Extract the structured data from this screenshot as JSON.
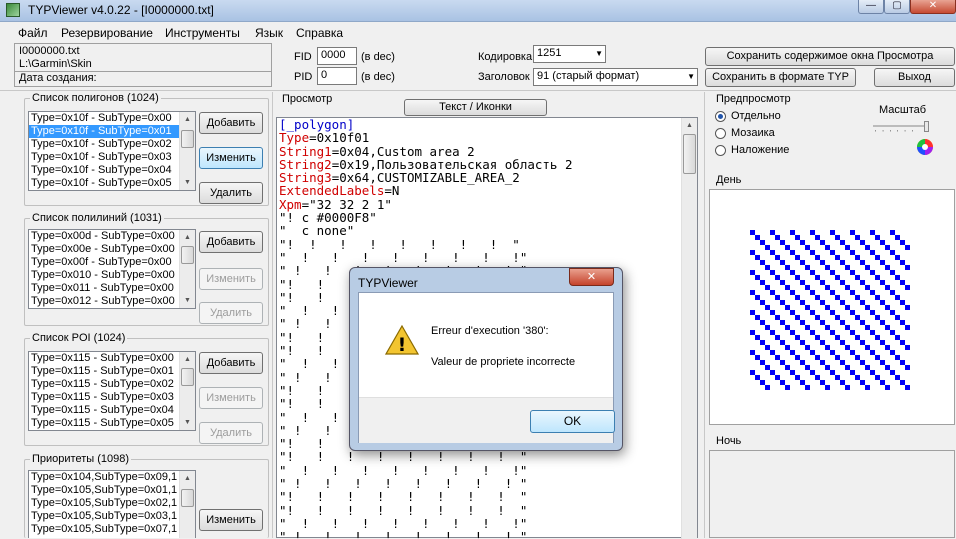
{
  "window": {
    "title": "TYPViewer v4.0.22 - [I0000000.txt]",
    "min_glyph": "—",
    "max_glyph": "▢",
    "close_glyph": "✕"
  },
  "menu": [
    "Файл",
    "Резервирование",
    "Инструменты",
    "Язык",
    "Справка"
  ],
  "file_info": {
    "filename": "I0000000.txt",
    "path": "L:\\Garmin\\Skin",
    "created_label": "Дата создания:"
  },
  "fid": {
    "label": "FID",
    "value": "0000",
    "unit": "(в dec)"
  },
  "pid": {
    "label": "PID",
    "value": "0",
    "unit": "(в dec)"
  },
  "encoding": {
    "label": "Кодировка",
    "value": "1251"
  },
  "header": {
    "label": "Заголовок",
    "value": "91 (старый формат)"
  },
  "top_buttons": {
    "save_view": "Сохранить содержимое окна Просмотра",
    "save_typ": "Сохранить в формате TYP",
    "exit": "Выход"
  },
  "polygons": {
    "title": "Список полигонов  (1024)",
    "items": [
      "Type=0x10f - SubType=0x00",
      "Type=0x10f - SubType=0x01",
      "Type=0x10f - SubType=0x02",
      "Type=0x10f - SubType=0x03",
      "Type=0x10f - SubType=0x04",
      "Type=0x10f - SubType=0x05"
    ],
    "selected_index": 1,
    "add": "Добавить",
    "edit": "Изменить",
    "delete": "Удалить"
  },
  "polylines": {
    "title": "Список полилиний  (1031)",
    "items": [
      "Type=0x00d - SubType=0x00",
      "Type=0x00e - SubType=0x00",
      "Type=0x00f - SubType=0x00",
      "Type=0x010 - SubType=0x00",
      "Type=0x011 - SubType=0x00",
      "Type=0x012 - SubType=0x00"
    ],
    "add": "Добавить",
    "edit": "Изменить",
    "delete": "Удалить"
  },
  "poi": {
    "title": "Список POI  (1024)",
    "items": [
      "Type=0x115 - SubType=0x00",
      "Type=0x115 - SubType=0x01",
      "Type=0x115 - SubType=0x02",
      "Type=0x115 - SubType=0x03",
      "Type=0x115 - SubType=0x04",
      "Type=0x115 - SubType=0x05"
    ],
    "add": "Добавить",
    "edit": "Изменить",
    "delete": "Удалить"
  },
  "priorities": {
    "title": "Приоритеты  (1098)",
    "items": [
      "Type=0x104,SubType=0x09,1",
      "Type=0x105,SubType=0x01,1",
      "Type=0x105,SubType=0x02,1",
      "Type=0x105,SubType=0x03,1",
      "Type=0x105,SubType=0x07,1"
    ],
    "edit": "Изменить"
  },
  "view": {
    "title": "Просмотр",
    "toggle_button": "Текст / Иконки",
    "lines": [
      {
        "t": "[_polygon]",
        "c": "br"
      },
      {
        "t": "Type=0x10f01",
        "k": "Type",
        "v": "=0x10f01"
      },
      {
        "t": "String1=0x04,Custom area 2",
        "k": "String1",
        "v": "=0x04,Custom area 2"
      },
      {
        "t": "String2=0x19,Пользовательская область 2",
        "k": "String2",
        "v": "=0x19,Пользовательская область 2"
      },
      {
        "t": "String3=0x64,CUSTOMIZABLE_AREA_2",
        "k": "String3",
        "v": "=0x64,CUSTOMIZABLE_AREA_2"
      },
      {
        "t": "ExtendedLabels=N",
        "k": "ExtendedLabels",
        "v": "=N"
      },
      {
        "t": "Xpm=\"32 32 2 1\"",
        "k": "Xpm",
        "v": "=\"32 32 2 1\""
      },
      {
        "t": "\"! c #0000F8\""
      },
      {
        "t": "\"  c none\""
      },
      {
        "t": "\"!  !   !   !   !   !   !   !  \""
      },
      {
        "t": "\"  !   !   !   !   !   !   !   !\""
      },
      {
        "t": "\" !   !   !   !   !   !   !   ! \""
      },
      {
        "t": "\"!   !   !   !   !   !   !   !  \""
      },
      {
        "t": "\"!   !   !   !   !   !   !   !  \""
      },
      {
        "t": "\"  !   !   !   !   !   !   !   !\""
      },
      {
        "t": "\" !   !   !   !   !   !   !   ! \""
      },
      {
        "t": "\"!   !   !   !   !   !   !   !  \""
      },
      {
        "t": "\"!   !   !   !   !   !   !   !  \""
      },
      {
        "t": "\"  !   !   !   !   !   !   !   !\""
      },
      {
        "t": "\" !   !   !   !   !   !   !   ! \""
      },
      {
        "t": "\"!   !   !   !   !   !   !   !  \""
      },
      {
        "t": "\"!   !   !   !   !   !   !   !  \""
      },
      {
        "t": "\"  !   !   !   !   !   !   !   !\""
      },
      {
        "t": "\" !   !   !   !   !   !   !   ! \""
      },
      {
        "t": "\"!   !   !   !   !   !   !   !  \""
      },
      {
        "t": "\"!   !   !   !   !   !   !   !  \""
      },
      {
        "t": "\"  !   !   !   !   !   !   !   !\""
      },
      {
        "t": "\" !   !   !   !   !   !   !   ! \""
      },
      {
        "t": "\"!   !   !   !   !   !   !   !  \""
      },
      {
        "t": "\"!   !   !   !   !   !   !   !  \""
      },
      {
        "t": "\"  !   !   !   !   !   !   !   !\""
      },
      {
        "t": "\" !   !   !   !   !   !   !   ! \""
      }
    ]
  },
  "preview": {
    "title": "Предпросмотр",
    "options": [
      "Отдельно",
      "Мозаика",
      "Наложение"
    ],
    "selected_option": 0,
    "scale_label": "Масштаб",
    "day_label": "День",
    "night_label": "Ночь",
    "pattern_color": "#0000F8"
  },
  "dialog": {
    "title": "TYPViewer",
    "line1": "Erreur d'execution '380':",
    "line2": "Valeur de propriete incorrecte",
    "ok": "OK",
    "close_glyph": "✕",
    "icon_glyph": "!"
  },
  "colors": {
    "keyword": "#d00000",
    "section": "#0000c8",
    "selection": "#3399ff"
  }
}
